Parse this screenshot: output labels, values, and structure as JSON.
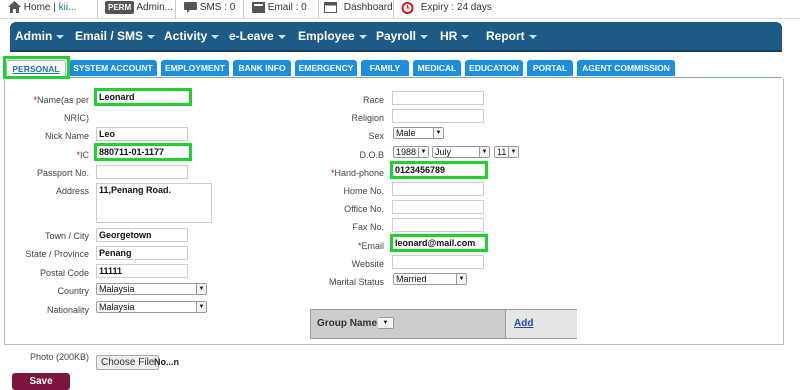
{
  "topbar": {
    "home_label": "Home | ",
    "home_user": "kii...",
    "perm_badge": "PERM",
    "admin_label": "Admin...",
    "sms_label": "SMS : 0",
    "email_label": "Email : 0",
    "dashboard_label": "Dashboard",
    "expiry_label": "Expiry : 24 days"
  },
  "nav": [
    "Admin",
    "Email / SMS",
    "Activity",
    "e-Leave",
    "Employee",
    "Payroll",
    "HR",
    "Report"
  ],
  "tabs": [
    "PERSONAL",
    "SYSTEM ACCOUNT",
    "EMPLOYMENT",
    "BANK INFO",
    "EMERGENCY",
    "FAMILY",
    "MEDICAL",
    "EDUCATION",
    "PORTAL",
    "AGENT COMMISSION"
  ],
  "left": {
    "name_label": "Name(as per",
    "nric_label": "NRIC)",
    "name_value": "Leonard",
    "nick_label": "Nick Name",
    "nick_value": "Leo",
    "ic_label": "IC",
    "ic_value": "880711-01-1177",
    "passport_label": "Passport No.",
    "passport_value": "",
    "address_label": "Address",
    "address_value": "11,Penang Road.",
    "town_label": "Town / City",
    "town_value": "Georgetown",
    "state_label": "State / Province",
    "state_value": "Penang",
    "postal_label": "Postal Code",
    "postal_value": "11111",
    "country_label": "Country",
    "country_value": "Malaysia",
    "nationality_label": "Nationality",
    "nationality_value": "Malaysia"
  },
  "right": {
    "race_label": "Race",
    "religion_label": "Religion",
    "sex_label": "Sex",
    "sex_value": "Male",
    "dob_label": "D.O.B",
    "dob_year": "1988",
    "dob_month": "July",
    "dob_day": "11",
    "handphone_label": "Hand-phone",
    "handphone_value": "0123456789",
    "homeno_label": "Home No.",
    "officeno_label": "Office No.",
    "faxno_label": "Fax No.",
    "email_label": "Email",
    "email_value": "leonard@mail.com",
    "website_label": "Website",
    "marital_label": "Marital Status",
    "marital_value": "Married"
  },
  "group": {
    "header": "Group Name",
    "add_label": "Add"
  },
  "photo": {
    "label": "Photo (200KB)",
    "choose_label": "Choose File",
    "file_name": "No...n"
  },
  "save_label": "Save",
  "colors": {
    "nav_bg": "#1e5a86",
    "tab_bg": "#1c8ee0",
    "highlight": "#1fd22f",
    "save_bg": "#7b1540"
  }
}
